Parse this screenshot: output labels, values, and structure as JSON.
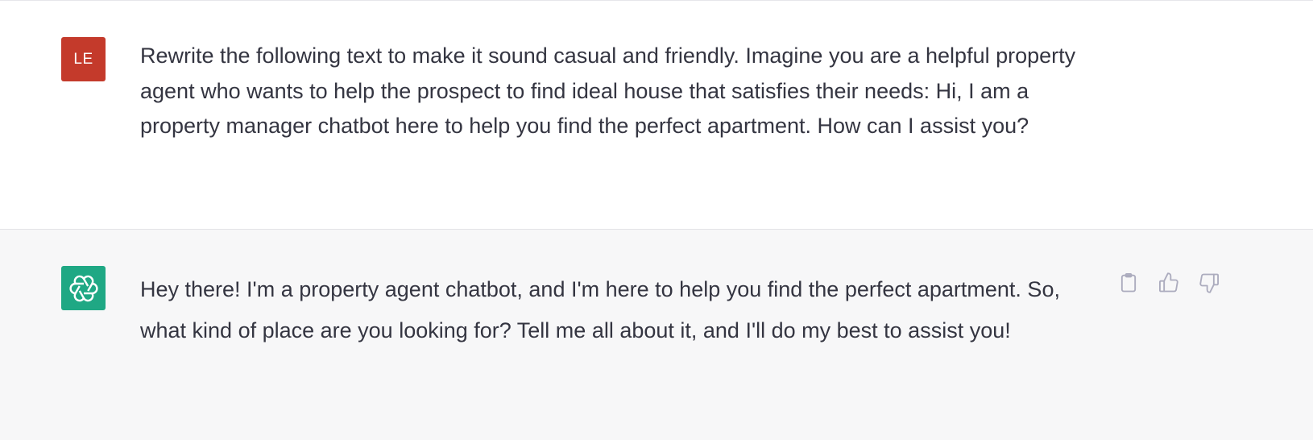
{
  "user_message": {
    "avatar_initials": "LE",
    "avatar_color": "#c43a2b",
    "text": "Rewrite the following text to make it sound casual and friendly. Imagine you are a helpful property agent who wants to help the prospect to find ideal house that satisfies their needs: Hi, I am a property manager chatbot here to help you find the perfect apartment. How can I assist you?"
  },
  "assistant_message": {
    "avatar_icon": "openai-logo-icon",
    "avatar_color": "#1fa884",
    "text": "Hey there! I'm a property agent chatbot, and I'm here to help you find the perfect apartment. So, what kind of place are you looking for? Tell me all about it, and I'll do my best to assist you!",
    "actions": {
      "copy_icon": "clipboard-icon",
      "like_icon": "thumbs-up-icon",
      "dislike_icon": "thumbs-down-icon"
    }
  },
  "colors": {
    "user_bg": "#ffffff",
    "assistant_bg": "#f7f7f8",
    "text": "#343541",
    "icon": "#acacbe"
  }
}
